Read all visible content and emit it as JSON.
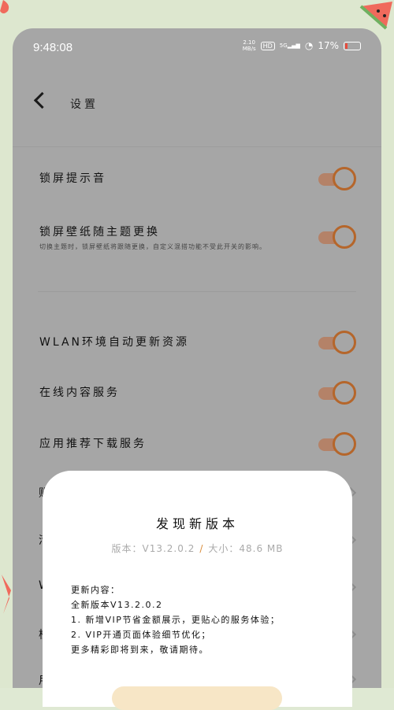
{
  "status_bar": {
    "time": "9:48:08",
    "net_speed_value": "2.10",
    "net_speed_unit": "MB/s",
    "hd_label": "HD",
    "signal_label": "5G",
    "battery": "17%"
  },
  "header": {
    "title": "设置"
  },
  "settings": [
    {
      "label": "锁屏提示音",
      "enabled": true
    },
    {
      "label": "锁屏壁纸随主题更换",
      "sub": "切换主题时，锁屏壁纸将跟随更换，自定义混搭功能不受此开关的影响。",
      "enabled": true
    },
    {
      "label": "WLAN环境自动更新资源",
      "enabled": true
    },
    {
      "label": "在线内容服务",
      "enabled": true
    },
    {
      "label": "应用推荐下载服务",
      "enabled": true
    }
  ],
  "partial_rows": [
    "账",
    "清",
    "W",
    "检",
    "用"
  ],
  "update_dialog": {
    "title": "发现新版本",
    "version_label": "版本：V13.2.0.2",
    "size_label": "大小：48.6 MB",
    "notes": [
      "更新内容：",
      "全新版本V13.2.0.2",
      "1. 新增VIP节省金额展示，更贴心的服务体验；",
      "2. VIP开通页面体验细节优化；",
      "更多精彩即将到来，敬请期待。"
    ]
  },
  "colors": {
    "toggle_track": "#b48268",
    "toggle_knob": "#b5662b",
    "accent_slash": "#d98c3a"
  }
}
